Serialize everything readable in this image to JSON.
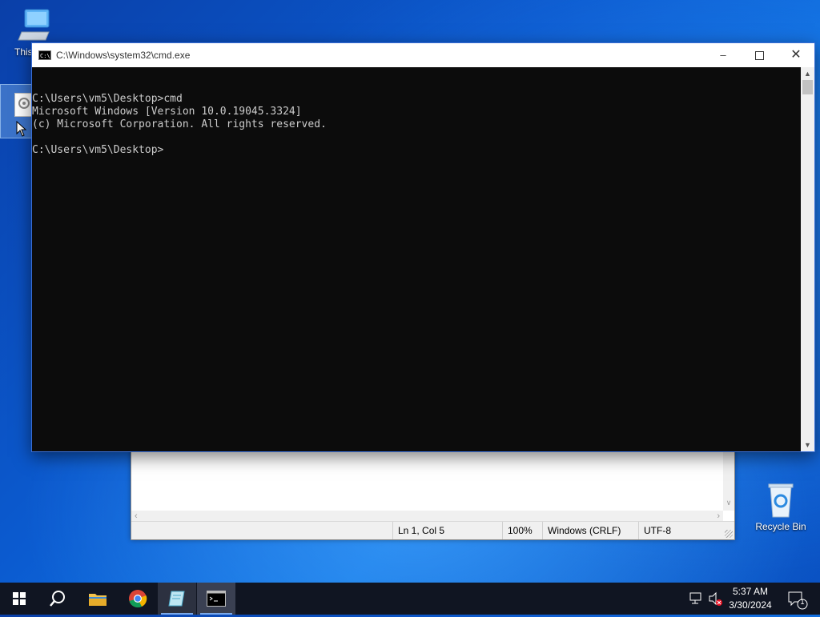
{
  "desktop": {
    "icons": [
      {
        "label": "This PC"
      },
      {
        "label": "Recycle Bin"
      }
    ]
  },
  "cmd_window": {
    "title": "C:\\Windows\\system32\\cmd.exe",
    "lines": [
      "C:\\Users\\vm5\\Desktop>cmd",
      "Microsoft Windows [Version 10.0.19045.3324]",
      "(c) Microsoft Corporation. All rights reserved.",
      "",
      "C:\\Users\\vm5\\Desktop>"
    ]
  },
  "notepad": {
    "status": {
      "position": "Ln 1, Col 5",
      "zoom": "100%",
      "line_ending": "Windows (CRLF)",
      "encoding": "UTF-8"
    }
  },
  "taskbar": {
    "apps": [
      "start-icon",
      "search-icon",
      "file-explorer-icon",
      "chrome-icon",
      "notepad-icon",
      "cmd-icon"
    ],
    "clock": {
      "time": "5:37 AM",
      "date": "3/30/2024"
    },
    "notification_count": "1"
  },
  "colors": {
    "accent": "#0b5bd0",
    "console_bg": "#0c0c0c",
    "console_fg": "#cccccc",
    "taskbar": "#101522"
  }
}
